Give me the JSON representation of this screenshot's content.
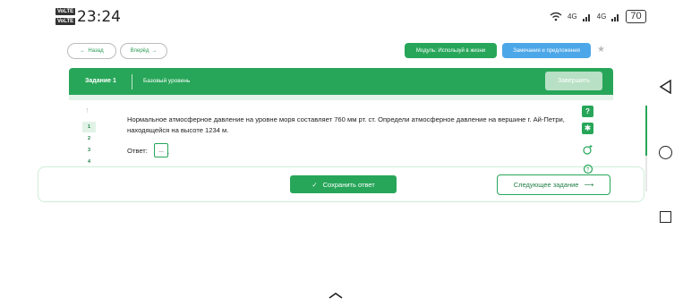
{
  "status_bar": {
    "sim1": "VoLTE",
    "sim2": "VoLTE",
    "time": "23:24",
    "net1": "4G",
    "net2": "4G",
    "battery": "70"
  },
  "top_buttons": {
    "back": "Назад",
    "forward": "Вперёд",
    "module": "Модуль: Используй в жизни",
    "notes": "Замечания и предложения"
  },
  "task_header": {
    "task": "Задание 1",
    "level": "Базовый уровень",
    "finish": "Завершить"
  },
  "question_nav": [
    "1",
    "2",
    "3",
    "4"
  ],
  "question": {
    "text": "Нормальное атмосферное давление на уровне моря составляет 760 мм рт. ст. Определи атмосферное давление на вершине г. Ай-Петри, находящейся на высоте 1234 м.",
    "answer_label": "Ответ:",
    "answer_placeholder": "...",
    "answer_suffix": "."
  },
  "side_icons": [
    "help-icon",
    "settings-icon",
    "hint-icon",
    "hint-icon"
  ],
  "footer": {
    "save": "Сохранить ответ",
    "next": "Следующее задание"
  },
  "colors": {
    "primary_green": "#27a659",
    "accent_blue": "#4ca7e8"
  }
}
